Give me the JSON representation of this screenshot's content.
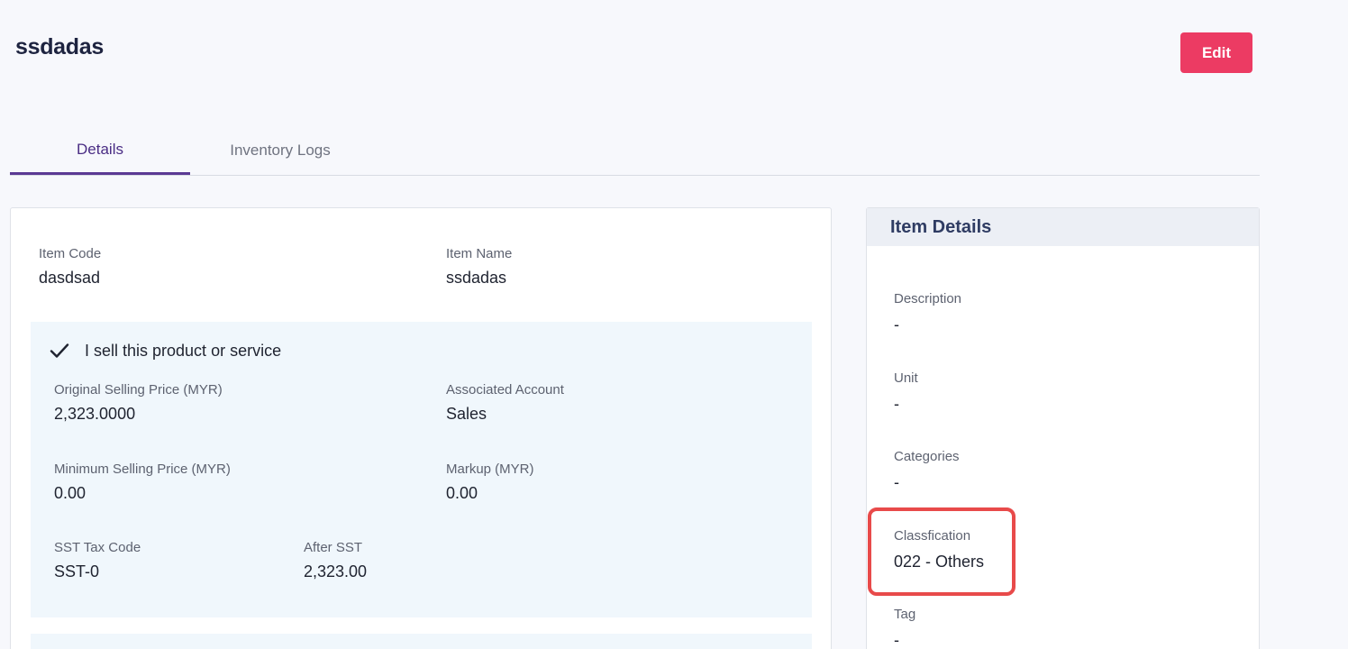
{
  "page": {
    "title": "ssdadas",
    "edit_label": "Edit"
  },
  "tabs": [
    {
      "label": "Details",
      "active": true
    },
    {
      "label": "Inventory Logs",
      "active": false
    }
  ],
  "item": {
    "code_label": "Item Code",
    "code_value": "dasdsad",
    "name_label": "Item Name",
    "name_value": "ssdadas"
  },
  "sell": {
    "check_label": "I sell this product or service",
    "checked": true,
    "fields": {
      "orig_price": {
        "label": "Original Selling Price (MYR)",
        "value": "2,323.0000"
      },
      "account": {
        "label": "Associated Account",
        "value": "Sales"
      },
      "min_price": {
        "label": "Minimum Selling Price (MYR)",
        "value": "0.00"
      },
      "markup": {
        "label": "Markup (MYR)",
        "value": "0.00"
      },
      "sst_code": {
        "label": "SST Tax Code",
        "value": "SST-0"
      },
      "after_sst": {
        "label": "After SST",
        "value": "2,323.00"
      }
    }
  },
  "side": {
    "title": "Item Details",
    "description": {
      "label": "Description",
      "value": "-"
    },
    "unit": {
      "label": "Unit",
      "value": "-"
    },
    "categories": {
      "label": "Categories",
      "value": "-"
    },
    "classification": {
      "label": "Classfication",
      "value": "022 - Others"
    },
    "tag": {
      "label": "Tag",
      "value": "-"
    }
  },
  "colors": {
    "accent": "#ec3b63",
    "tab_active": "#5b3a94",
    "highlight": "#e84a4a",
    "panel_bg": "#f0f7fc"
  },
  "icons": {
    "check": "check-icon"
  }
}
